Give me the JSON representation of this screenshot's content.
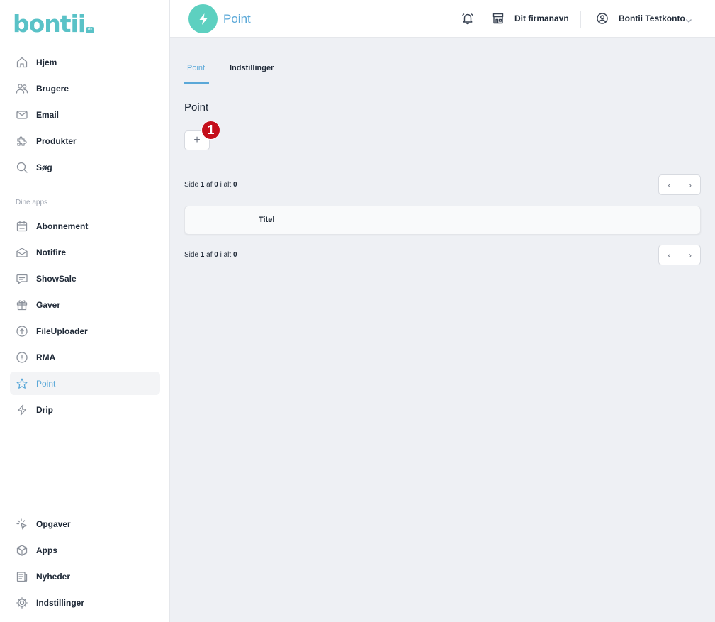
{
  "logo": {
    "text": "bontii",
    "suffix": "dk"
  },
  "sidebar": {
    "items": [
      {
        "label": "Hjem",
        "icon": "home-icon"
      },
      {
        "label": "Brugere",
        "icon": "users-icon"
      },
      {
        "label": "Email",
        "icon": "mail-icon"
      },
      {
        "label": "Produkter",
        "icon": "puzzle-icon"
      },
      {
        "label": "Søg",
        "icon": "search-icon"
      }
    ],
    "section_label": "Dine apps",
    "apps": [
      {
        "label": "Abonnement",
        "icon": "calendar-icon"
      },
      {
        "label": "Notifire",
        "icon": "envelope-open-icon"
      },
      {
        "label": "ShowSale",
        "icon": "chat-icon"
      },
      {
        "label": "Gaver",
        "icon": "gift-icon"
      },
      {
        "label": "FileUploader",
        "icon": "upload-icon"
      },
      {
        "label": "RMA",
        "icon": "alert-circle-icon"
      },
      {
        "label": "Point",
        "icon": "star-icon",
        "active": true
      },
      {
        "label": "Drip",
        "icon": "bolt-icon"
      }
    ],
    "bottom": [
      {
        "label": "Opgaver",
        "icon": "cursor-click-icon"
      },
      {
        "label": "Apps",
        "icon": "cube-icon"
      },
      {
        "label": "Nyheder",
        "icon": "newspaper-icon"
      },
      {
        "label": "Indstillinger",
        "icon": "gear-icon"
      }
    ]
  },
  "header": {
    "app_title": "Point",
    "app_icon": "bolt-icon",
    "company": "Dit firmanavn",
    "user": "Bontii Testkonto"
  },
  "tabs": [
    {
      "label": "Point",
      "active": true
    },
    {
      "label": "Indstillinger"
    }
  ],
  "main": {
    "title": "Point",
    "add_label": "+",
    "marker": "1",
    "pager": {
      "prefix": "Side",
      "page": "1",
      "of": "af",
      "pages": "0",
      "total_word": "i alt",
      "total": "0",
      "prev": "‹",
      "next": "›"
    },
    "table": {
      "columns": [
        "Titel"
      ]
    }
  },
  "colors": {
    "accent": "#5aa8d8",
    "brand": "#5ac2c7",
    "badge": "#5dd0c0",
    "marker": "#c40e1a"
  }
}
